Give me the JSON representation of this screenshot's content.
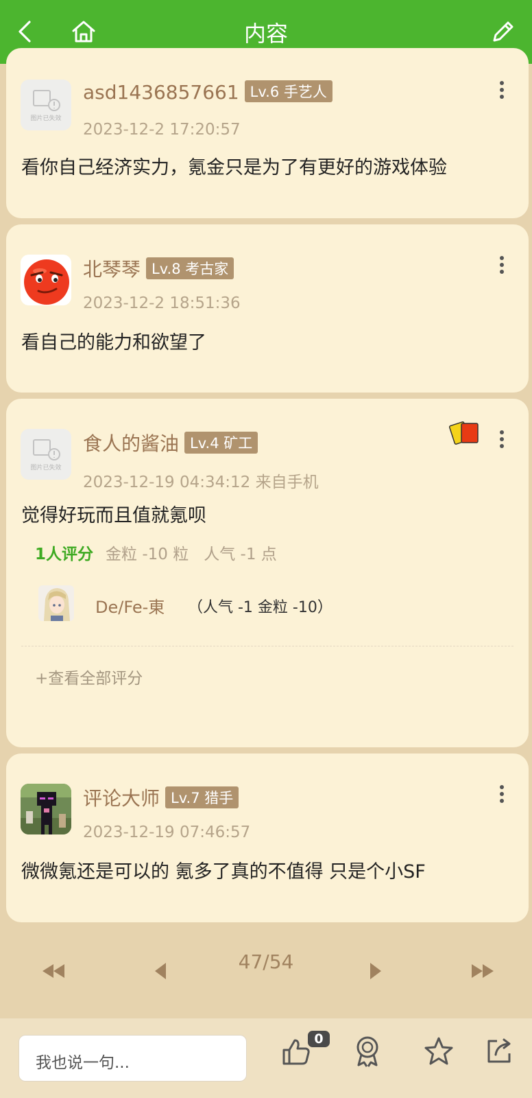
{
  "header": {
    "title": "内容"
  },
  "posts": [
    {
      "username": "asd1436857661",
      "level": "Lv.6 手艺人",
      "time": "2023-12-2 17:20:57",
      "content": "看你自己经济实力，氪金只是为了有更好的游戏体验",
      "avatar_caption": "图片已失效"
    },
    {
      "username": "北琴琴",
      "level": "Lv.8 考古家",
      "time": "2023-12-2 18:51:36",
      "content": "看自己的能力和欲望了"
    },
    {
      "username": "食人的酱油",
      "level": "Lv.4 矿工",
      "time": "2023-12-19 04:34:12 来自手机",
      "content": "觉得好玩而且值就氪呗",
      "avatar_caption": "图片已失效",
      "rating": {
        "count": "1人评分",
        "gold": "金粒 -10 粒",
        "popularity": "人气 -1 点",
        "rater_name": "De/Fe-東",
        "rater_detail": "（人气 -1 金粒 -10）",
        "view_all": "+查看全部评分"
      }
    },
    {
      "username": "评论大师",
      "level": "Lv.7 猎手",
      "time": "2023-12-19 07:46:57",
      "content": "微微氪还是可以的 氪多了真的不值得 只是个小SF"
    }
  ],
  "pager": {
    "label": "47/54"
  },
  "bottom": {
    "reply_placeholder": "我也说一句...",
    "like_count": "0"
  },
  "colors": {
    "header_green": "#4cb52f",
    "card_bg": "#fcf2d6",
    "page_bg": "#e6d3ae",
    "username": "#9a7452",
    "level_badge": "#b0936e",
    "rating_green": "#3eaa22"
  }
}
